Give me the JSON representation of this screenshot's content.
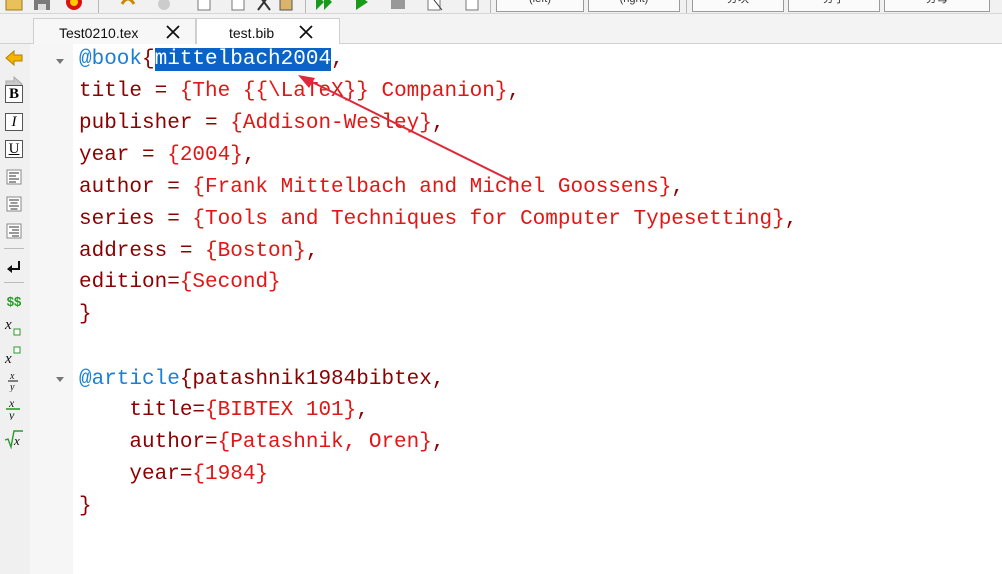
{
  "toolbar": {
    "btn_left_label": "(left)",
    "btn_right_label": "(right)",
    "btn3_label": "分块",
    "btn4_label": "分子",
    "btn5_label": "分母"
  },
  "tabs": [
    {
      "label": "Test0210.tex",
      "active": false
    },
    {
      "label": "test.bib",
      "active": true
    }
  ],
  "sidebar": {
    "bold": "B",
    "italic": "I",
    "underline": "U",
    "dollars": "$$"
  },
  "editor": {
    "line1": {
      "kw": "@book",
      "open": "{",
      "key": "mittelbach2004",
      "rest": ","
    },
    "line2": {
      "field": "title = ",
      "value": "{The {{\\LaTeX}} Companion}",
      "end": ","
    },
    "line3": {
      "field": "publisher = ",
      "value": "{Addison-Wesley}",
      "end": ","
    },
    "line4": {
      "field": "year = ",
      "value": "{2004}",
      "end": ","
    },
    "line5": {
      "field": "author = ",
      "value": "{Frank Mittelbach and Michel Goossens}",
      "end": ","
    },
    "line6": {
      "field": "series = ",
      "value": "{Tools and Techniques for Computer Typesetting}",
      "end": ","
    },
    "line7": {
      "field": "address = ",
      "value": "{Boston}",
      "end": ","
    },
    "line8": {
      "field": "edition=",
      "value": "{Second}",
      "end": ""
    },
    "line9": {
      "text": "}"
    },
    "line11": {
      "kw": "@article",
      "rest": "{patashnik1984bibtex,"
    },
    "line12": {
      "field": "    title=",
      "value": "{BIBTEX 101}",
      "end": ","
    },
    "line13": {
      "field": "    author=",
      "value": "{Patashnik, Oren}",
      "end": ","
    },
    "line14": {
      "field": "    year=",
      "value": "{1984}",
      "end": ""
    },
    "line15": {
      "text": "}"
    }
  },
  "colors": {
    "keyword": "#1a7fd8",
    "string": "#e31515",
    "text": "#8b0000",
    "selection": "#0a64c8",
    "annotation_arrow": "#e0283a"
  }
}
